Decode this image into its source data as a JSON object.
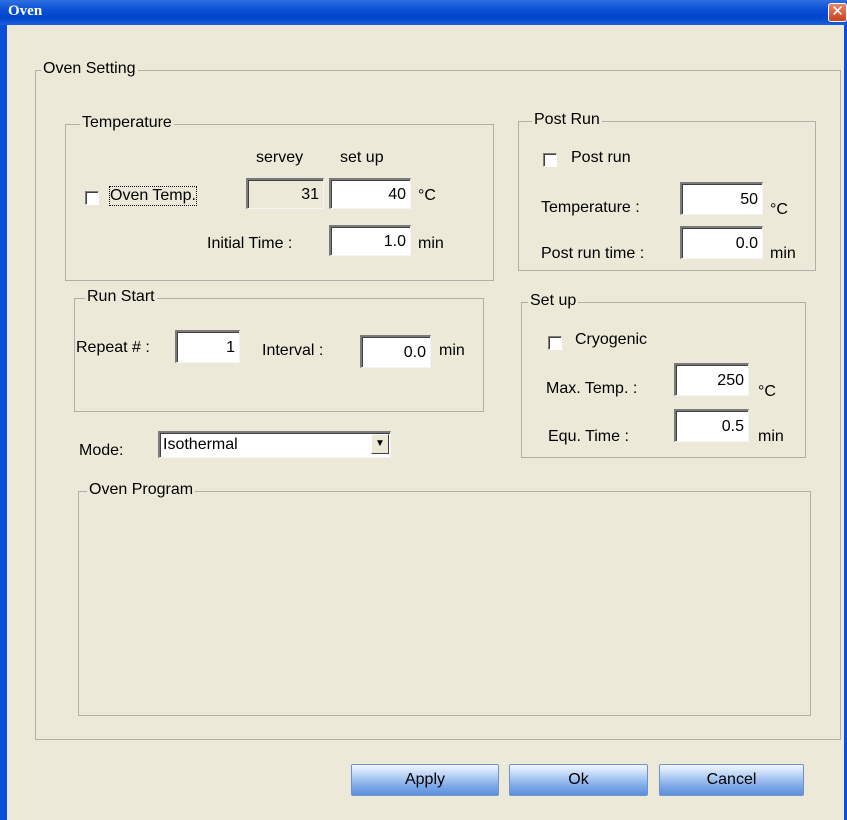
{
  "window": {
    "title": "Oven",
    "close_glyph": "✕"
  },
  "oven_setting": {
    "legend": "Oven Setting",
    "temperature": {
      "legend": "Temperature",
      "servey_header": "servey",
      "setup_header": "set up",
      "oven_temp_label": "Oven Temp.",
      "oven_temp_checked": false,
      "servey_value": "31",
      "setup_value": "40",
      "temp_unit": "°C",
      "initial_time_label": "Initial Time :",
      "initial_time_value": "1.0",
      "time_unit": "min"
    },
    "post_run": {
      "legend": "Post Run",
      "post_run_label": "Post run",
      "post_run_checked": false,
      "temperature_label": "Temperature :",
      "temperature_value": "50",
      "temp_unit": "°C",
      "time_label": "Post run time :",
      "time_value": "0.0",
      "time_unit": "min"
    },
    "run_start": {
      "legend": "Run Start",
      "repeat_label": "Repeat # :",
      "repeat_value": "1",
      "interval_label": "Interval :",
      "interval_value": "0.0",
      "interval_unit": "min"
    },
    "set_up": {
      "legend": "Set up",
      "cryogenic_label": "Cryogenic",
      "cryogenic_checked": false,
      "max_temp_label": "Max. Temp. :",
      "max_temp_value": "250",
      "max_temp_unit": "°C",
      "equ_time_label": "Equ. Time :",
      "equ_time_value": "0.5",
      "equ_time_unit": "min"
    },
    "mode": {
      "label": "Mode:",
      "selected": "Isothermal",
      "arrow_glyph": "▼"
    },
    "oven_program": {
      "legend": "Oven Program"
    }
  },
  "buttons": {
    "apply": "Apply",
    "ok": "Ok",
    "cancel": "Cancel"
  }
}
